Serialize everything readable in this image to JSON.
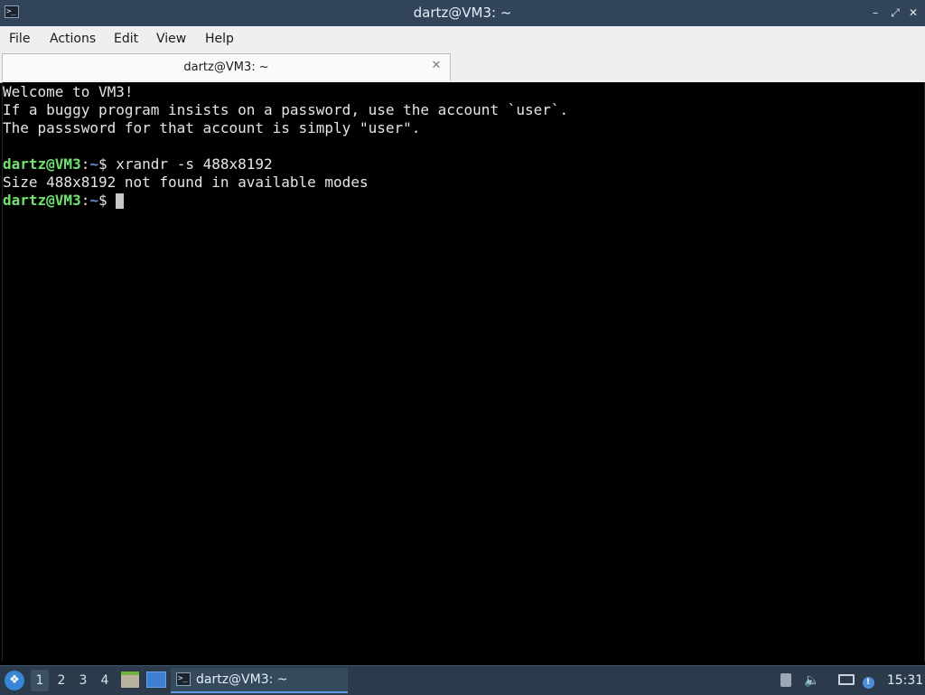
{
  "window": {
    "title": "dartz@VM3: ~",
    "app_icon_glyph": ">_",
    "controls": {
      "minimize": "–",
      "maximize": "⤢",
      "close": "✕"
    }
  },
  "menubar": {
    "items": [
      "File",
      "Actions",
      "Edit",
      "View",
      "Help"
    ]
  },
  "tabs": [
    {
      "label": "dartz@VM3: ~",
      "close_glyph": "✕"
    }
  ],
  "terminal": {
    "lines": [
      "Welcome to VM3!",
      "If a buggy program insists on a password, use the account `user`.",
      "The passsword for that account is simply \"user\"."
    ],
    "prompt_user": "dartz@VM3",
    "prompt_sep": ":",
    "prompt_path": "~",
    "prompt_symbol": "$",
    "command": " xrandr -s 488x8192",
    "output": "Size 488x8192 not found in available modes"
  },
  "taskbar": {
    "start_glyph": "❖",
    "workspaces": [
      "1",
      "2",
      "3",
      "4"
    ],
    "active_workspace": "1",
    "task_label": "dartz@VM3: ~",
    "task_icon_glyph": ">_",
    "volume_glyph": "🔈",
    "update_glyph": "!",
    "clock": "15:31"
  },
  "colors": {
    "titlebar": "#314459",
    "taskbar": "#2c3b4b",
    "prompt_user": "#6fe26f",
    "prompt_path": "#5f8fe0",
    "terminal_bg": "#000000",
    "terminal_fg": "#e5e5e5"
  }
}
